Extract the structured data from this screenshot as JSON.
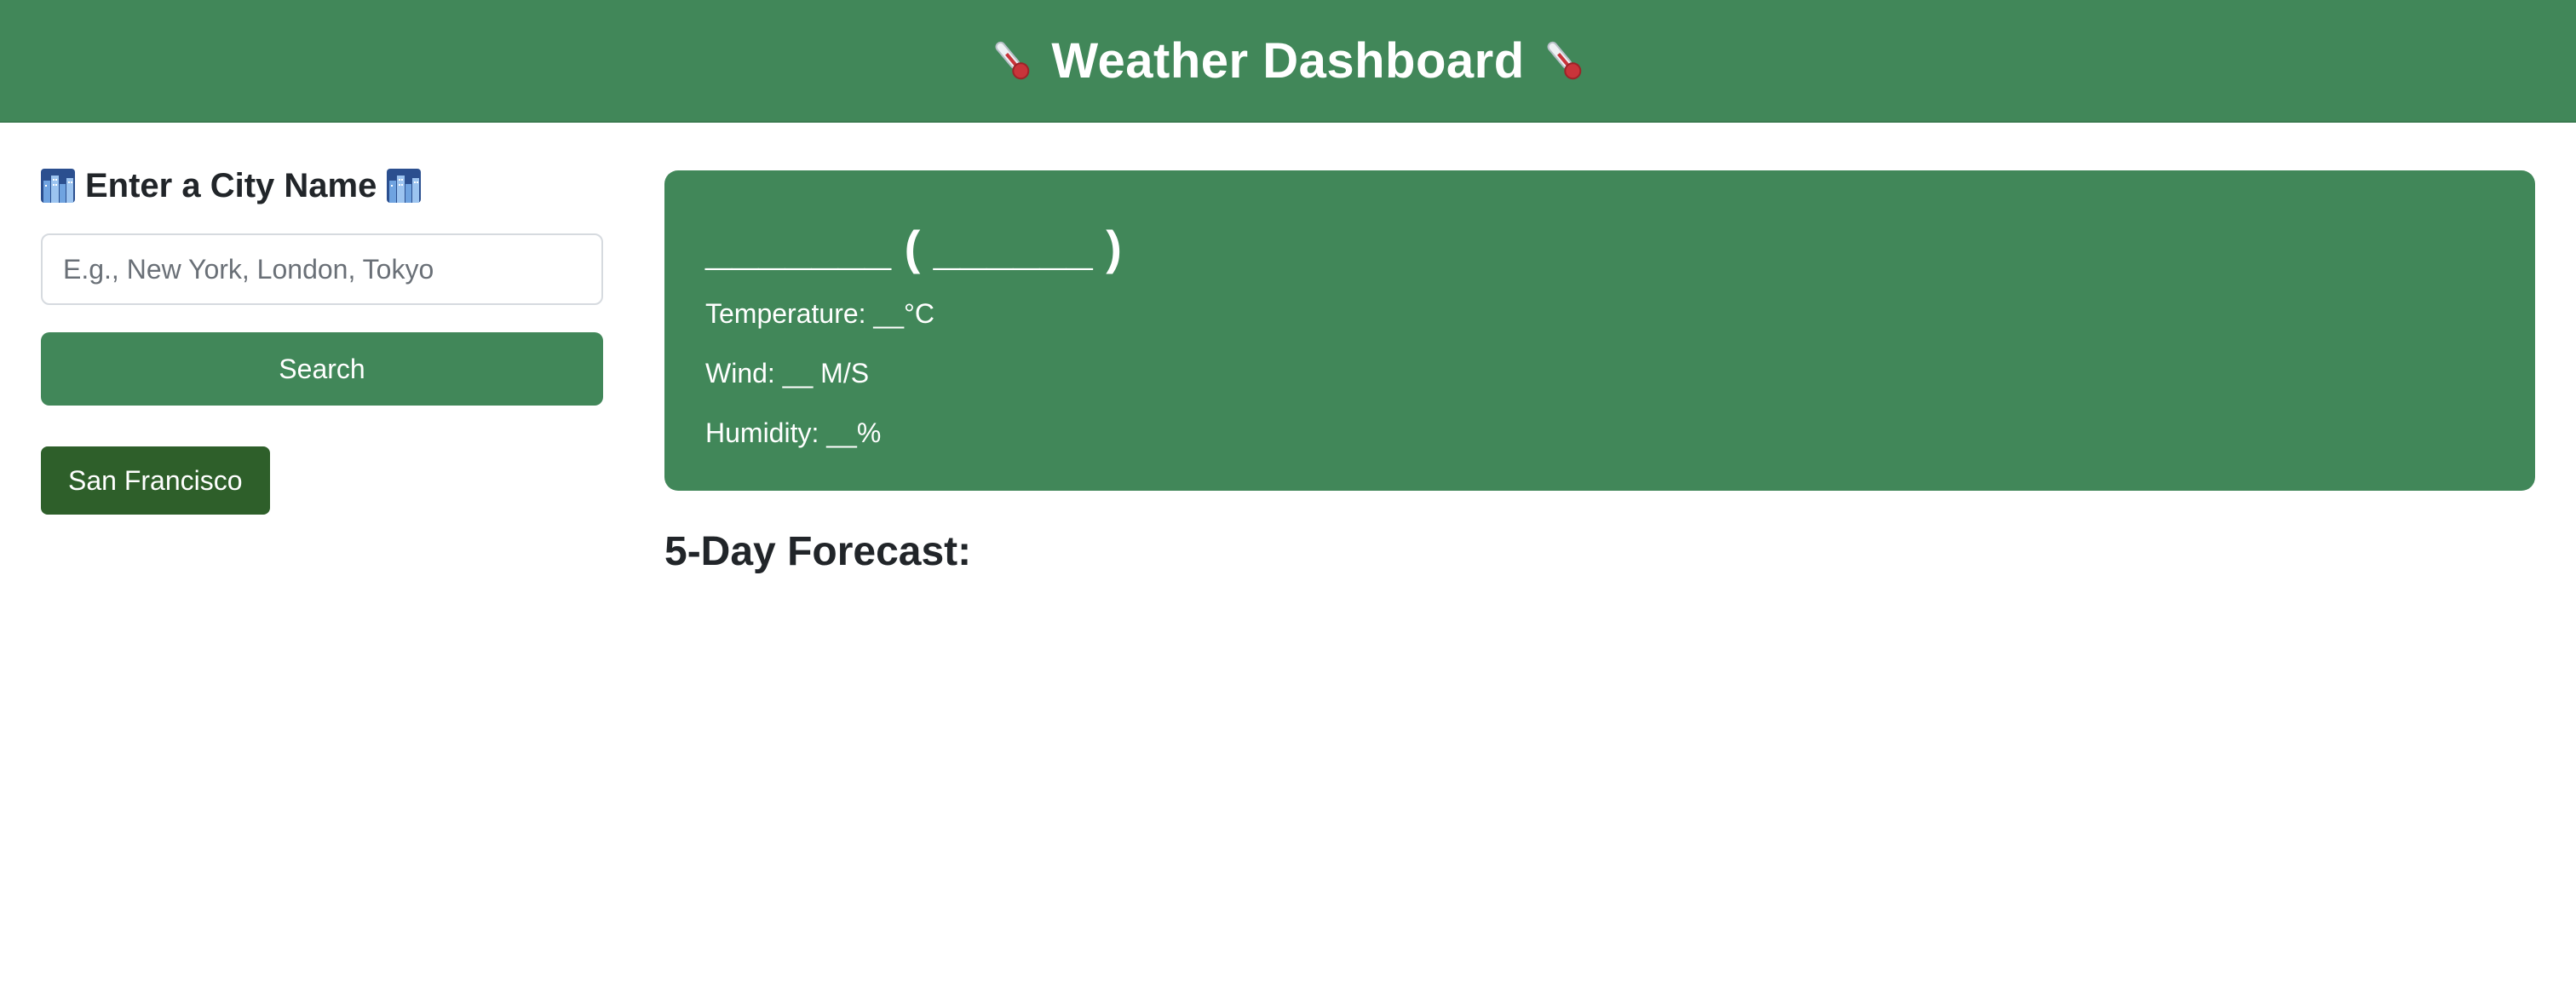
{
  "header": {
    "title": "Weather Dashboard",
    "icon": "thermometer-icon",
    "background_color": "#418759"
  },
  "sidebar": {
    "heading": "Enter a City Name",
    "heading_icon": "cityscape-icon",
    "search_input": {
      "value": "",
      "placeholder": "E.g., New York, London, Tokyo"
    },
    "search_button_label": "Search",
    "history": [
      {
        "label": "San Francisco"
      }
    ],
    "button_color": "#418759",
    "history_button_color": "#2e5f2a"
  },
  "current": {
    "title": "_______ ( ______ )",
    "temperature": "Temperature: __°C",
    "wind": "Wind: __ M/S",
    "humidity": "Humidity: __%",
    "card_color": "#418759"
  },
  "forecast": {
    "heading": "5-Day Forecast:"
  }
}
